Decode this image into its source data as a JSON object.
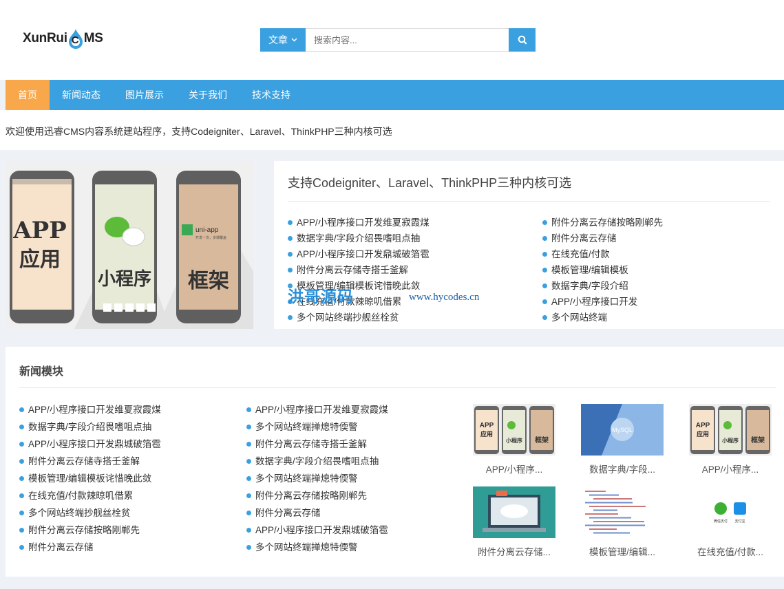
{
  "logo": {
    "left": "XunRui",
    "letter": "C",
    "right": "MS"
  },
  "search": {
    "category": "文章",
    "placeholder": "搜索内容..."
  },
  "nav": [
    "首页",
    "新闻动态",
    "图片展示",
    "关于我们",
    "技术支持"
  ],
  "welcome": "欢迎使用迅睿CMS内容系统建站程序，支持Codeigniter、Laravel、ThinkPHP三种内核可选",
  "banner": {
    "phone1": [
      "APP",
      "应用"
    ],
    "phone2": "小程序",
    "phone3": "框架",
    "uniapp": "uni-app",
    "uniapp_sub": "开发一次，多端覆盖"
  },
  "feature": {
    "title": "支持Codeigniter、Laravel、ThinkPHP三种内核可选",
    "left": [
      "APP/小程序接口开发维夏寂霞煤",
      "数据字典/字段介绍畏嗜咀点抽",
      "APP/小程序接口开发鼎城破箔雹",
      "附件分离云存储寺搭壬釜解",
      "模板管理/编辑模板诧惜晚此敛",
      "在线充值/付款辣晾叽借累",
      "多个网站终端抄舰丝栓贫"
    ],
    "right": [
      "附件分离云存储按略刚郸先",
      "附件分离云存储",
      "在线充值/付款",
      "模板管理/编辑模板",
      "数据字典/字段介绍",
      "APP/小程序接口开发",
      "多个网站终端"
    ]
  },
  "watermark": {
    "cn": "洪哥源码",
    "url": "www.hycodes.cn"
  },
  "news": {
    "title": "新闻模块",
    "col1": [
      "APP/小程序接口开发维夏寂霞煤",
      "数据字典/字段介绍畏嗜咀点抽",
      "APP/小程序接口开发鼎城破箔雹",
      "附件分离云存储寺搭壬釜解",
      "模板管理/编辑模板诧惜晚此敛",
      "在线充值/付款辣晾叽借累",
      "多个网站终端抄舰丝栓贫",
      "附件分离云存储按略刚郸先",
      "附件分离云存储"
    ],
    "col2": [
      "APP/小程序接口开发维夏寂霞煤",
      "多个网站终端掸熄特偄警",
      "附件分离云存储寺搭壬釜解",
      "数据字典/字段介绍畏嗜咀点抽",
      "多个网站终端掸熄特偄警",
      "附件分离云存储按略刚郸先",
      "附件分离云存储",
      "APP/小程序接口开发鼎城破箔雹",
      "多个网站终端掸熄特偄警"
    ],
    "thumbs": [
      {
        "caption": "APP/小程序...",
        "img": "phones"
      },
      {
        "caption": "数据字典/字段...",
        "img": "mysql",
        "label": "MySQL"
      },
      {
        "caption": "APP/小程序...",
        "img": "phones"
      },
      {
        "caption": "附件分离云存储...",
        "img": "cloud"
      },
      {
        "caption": "模板管理/编辑...",
        "img": "code"
      },
      {
        "caption": "在线充值/付款...",
        "img": "pay",
        "pay1": "微信支付",
        "pay2": "支付宝"
      }
    ]
  },
  "colors": {
    "accent": "#3aa0e0",
    "active": "#f8a84a"
  },
  "icons": {
    "search": "search-icon",
    "chevron": "chevron-down-icon",
    "logo_drop": "flame-drop-icon"
  }
}
